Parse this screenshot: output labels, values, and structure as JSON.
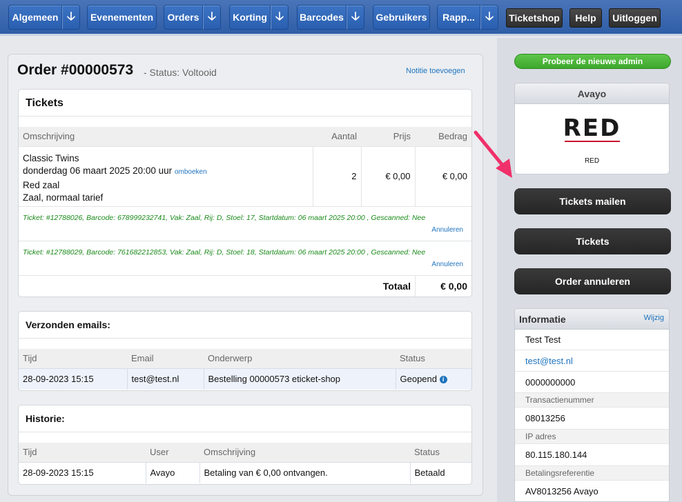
{
  "nav": {
    "algemeen": "Algemeen",
    "evenementen": "Evenementen",
    "orders": "Orders",
    "korting": "Korting",
    "barcodes": "Barcodes",
    "gebruikers": "Gebruikers",
    "rapportages": "Rapp...",
    "arrow": "🡣",
    "ticketshop": "Ticketshop",
    "help": "Help",
    "uitloggen": "Uitloggen"
  },
  "order": {
    "title": "Order #00000573",
    "status": "- Status: Voltooid",
    "add_note": "Notitie toevoegen"
  },
  "tickets": {
    "heading": "Tickets",
    "columns": [
      "Omschrijving",
      "Aantal",
      "Prijs",
      "Bedrag"
    ],
    "event_name": "Classic Twins",
    "event_date": "donderdag 06 maart 2025 20:00 uur",
    "rebook_link": "omboeken",
    "hall": "Red zaal",
    "tariff": "Zaal, normaal tarief",
    "quantity": "2",
    "price": "€ 0,00",
    "amount": "€ 0,00",
    "ticket_lines": [
      {
        "text": "Ticket: #12788026, Barcode: 678999232741, Vak: Zaal, Rij: D, Stoel: 17, Startdatum: 06 maart 2025 20:00 , Gescanned: Nee",
        "cancel": "Annuleren"
      },
      {
        "text": "Ticket: #12788029, Barcode: 761682212853, Vak: Zaal, Rij: D, Stoel: 18, Startdatum: 06 maart 2025 20:00 , Gescanned: Nee",
        "cancel": "Annuleren"
      }
    ],
    "total_label": "Totaal",
    "total_value": "€ 0,00"
  },
  "emails": {
    "heading": "Verzonden emails:",
    "columns": [
      "Tijd",
      "Email",
      "Onderwerp",
      "Status"
    ],
    "rows": [
      {
        "time": "28-09-2023 15:15",
        "email": "test@test.nl",
        "subject": "Bestelling 00000573 eticket-shop",
        "status": "Geopend"
      }
    ]
  },
  "history": {
    "heading": "Historie:",
    "columns": [
      "Tijd",
      "User",
      "Omschrijving",
      "Status"
    ],
    "rows": [
      {
        "time": "28-09-2023 15:15",
        "user": "Avayo",
        "description": "Betaling van € 0,00 ontvangen.",
        "status": "Betaald"
      }
    ]
  },
  "sidebar": {
    "try_new_admin": "Probeer de nieuwe admin",
    "org_name": "Avayo",
    "logo_text": "RED",
    "logo_caption": "RED",
    "btn_mail_tickets": "Tickets mailen",
    "btn_tickets": "Tickets",
    "btn_cancel_order": "Order annuleren",
    "info": {
      "heading": "Informatie",
      "edit": "Wijzig",
      "name": "Test Test",
      "email": "test@test.nl",
      "phone": "0000000000",
      "transaction_label": "Transactienummer",
      "transaction_value": "08013256",
      "ip_label": "IP adres",
      "ip_value": "80.115.180.144",
      "payref_label": "Betalingsreferentie",
      "payref_value": "AV8013256 Avayo"
    }
  },
  "colors": {
    "nav_blue": "#2f5ea7",
    "ticket_green": "#1a8a1a",
    "try_green": "#4cb83a",
    "annotation_arrow": "#f0306a"
  }
}
